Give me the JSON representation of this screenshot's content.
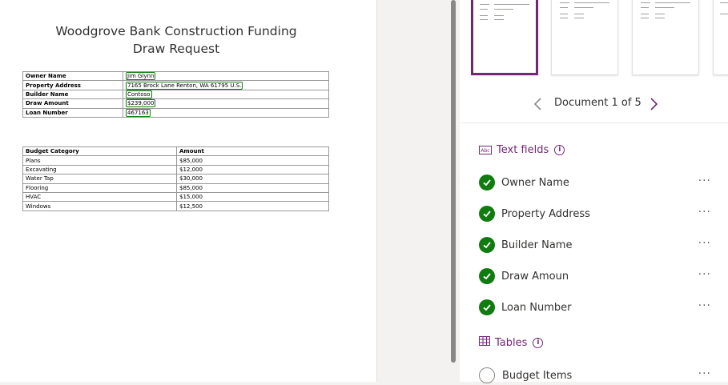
{
  "document": {
    "title_line1": "Woodgrove Bank Construction Funding",
    "title_line2": "Draw Request",
    "fields": [
      {
        "key": "Owner Name",
        "value": "Jim Glynn"
      },
      {
        "key": "Property Address",
        "value": "7165 Brock Lane Renton, WA 61795 U.S."
      },
      {
        "key": "Builder Name",
        "value": "Contoso"
      },
      {
        "key": "Draw Amount",
        "value": "$239,000"
      },
      {
        "key": "Loan Number",
        "value": "467163"
      }
    ],
    "budget_header": {
      "category": "Budget Category",
      "amount": "Amount"
    },
    "budget_rows": [
      {
        "category": "Plans",
        "amount": "$85,000"
      },
      {
        "category": "Excavating",
        "amount": "$12,000"
      },
      {
        "category": "Water Tap",
        "amount": "$30,000"
      },
      {
        "category": "Flooring",
        "amount": "$85,000"
      },
      {
        "category": "HVAC",
        "amount": "$15,000"
      },
      {
        "category": "Windows",
        "amount": "$12,500"
      }
    ]
  },
  "panel": {
    "nav": {
      "counter": "Document 1 of 5",
      "prev_icon": "chevron-left-icon",
      "next_icon": "chevron-right-icon"
    },
    "text_fields_section": {
      "label": "Text fields",
      "icon": "text-field-icon",
      "icon_text": "Abc",
      "info": "i"
    },
    "text_fields": [
      {
        "label": "Owner Name",
        "status": "complete",
        "more": "···"
      },
      {
        "label": "Property Address",
        "status": "complete",
        "more": "···"
      },
      {
        "label": "Builder Name",
        "status": "complete",
        "more": "···"
      },
      {
        "label": "Draw Amoun",
        "status": "complete",
        "more": "···"
      },
      {
        "label": "Loan Number",
        "status": "complete",
        "more": "···"
      }
    ],
    "tables_section": {
      "label": "Tables",
      "icon": "table-icon",
      "info": "i"
    },
    "tables": [
      {
        "label": "Budget Items",
        "status": "incomplete",
        "more": "···"
      }
    ]
  },
  "colors": {
    "accent": "#742774",
    "success": "#107c10"
  }
}
